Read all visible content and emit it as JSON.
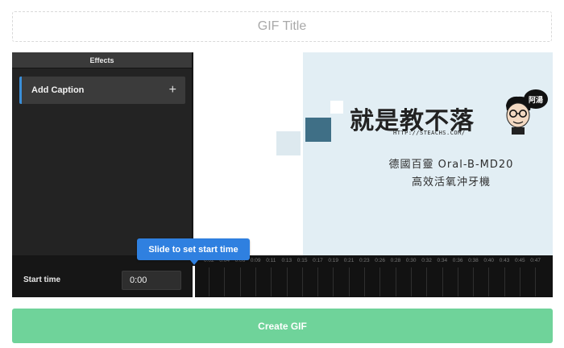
{
  "title_field": {
    "placeholder": "GIF Title"
  },
  "effects": {
    "header": "Effects",
    "add_caption_label": "Add Caption",
    "add_icon": "+"
  },
  "preview": {
    "logo_text": "就是教不落",
    "logo_url": "HTTP://STEACHS.COM/",
    "badge_text": "阿湯",
    "product_line1": "德國百靈 Oral-B-MD20",
    "product_line2": "高效活氧沖牙機",
    "colors": {
      "accent_square": "#3f6f86",
      "background_right": "#e2eef4"
    }
  },
  "timeline": {
    "start_label": "Start time",
    "start_value": "0:00",
    "tick_labels": [
      "0:02",
      "0:04",
      "0:06",
      "0:09",
      "0:11",
      "0:13",
      "0:15",
      "0:17",
      "0:19",
      "0:21",
      "0:23",
      "0:26",
      "0:28",
      "0:30",
      "0:32",
      "0:34",
      "0:36",
      "0:38",
      "0:40",
      "0:43",
      "0:45",
      "0:47"
    ],
    "tooltip": "Slide to set start time"
  },
  "create_button": {
    "label": "Create GIF",
    "color": "#6fd39a"
  }
}
